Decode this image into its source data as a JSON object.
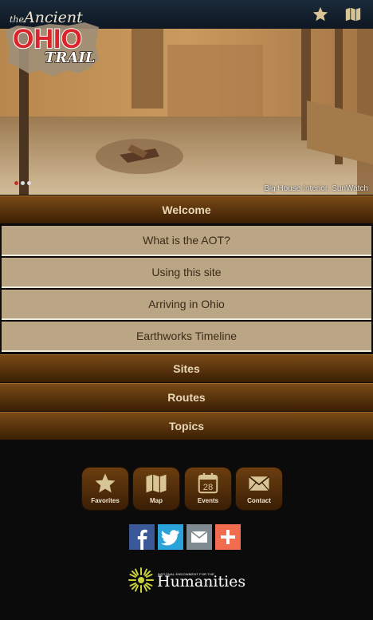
{
  "header": {
    "logo": {
      "the": "the",
      "ancient": "Ancient",
      "ohio": "OHIO",
      "trail": "TRAIL"
    },
    "icons": [
      "star-icon",
      "map-icon"
    ]
  },
  "hero": {
    "caption": "Big House Interior, SunWatch",
    "slide_count": 3,
    "active_slide": 1
  },
  "menu": {
    "welcome": "Welcome",
    "welcome_items": [
      "What is the AOT?",
      "Using this site",
      "Arriving in Ohio",
      "Earthworks Timeline"
    ],
    "sites": "Sites",
    "routes": "Routes",
    "topics": "Topics"
  },
  "footer": {
    "buttons": [
      {
        "label": "Favorites",
        "icon": "star-icon"
      },
      {
        "label": "Map",
        "icon": "map-icon"
      },
      {
        "label": "Events",
        "icon": "calendar-icon",
        "day": "28"
      },
      {
        "label": "Contact",
        "icon": "envelope-icon"
      }
    ],
    "social": [
      {
        "icon": "facebook-icon",
        "color": "#3b5998"
      },
      {
        "icon": "twitter-icon",
        "color": "#2aa3db"
      },
      {
        "icon": "email-share-icon",
        "color": "#7f8b91"
      },
      {
        "icon": "addthis-plus-icon",
        "color": "#f26c4f"
      }
    ],
    "neh": {
      "small": "NATIONAL ENDOWMENT FOR THE",
      "big": "Humanities"
    }
  },
  "colors": {
    "menu_bar": "#5a3309",
    "submenu": "#baa584",
    "header": "#142232",
    "accent": "#c0312b"
  }
}
